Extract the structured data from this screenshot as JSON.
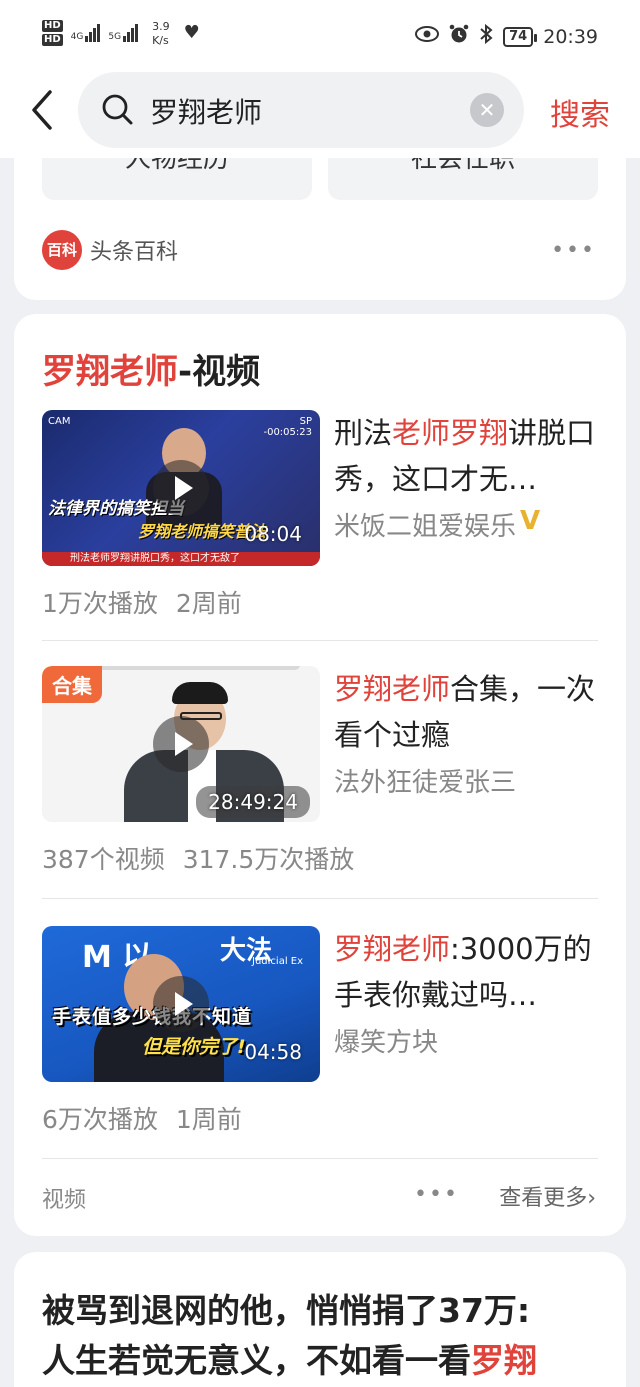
{
  "status_bar": {
    "hd1": "HD",
    "hd2": "HD",
    "net1": "4G",
    "net2": "5G",
    "speed_value": "3.9",
    "speed_unit": "K/s",
    "battery": "74",
    "time": "20:39"
  },
  "search": {
    "query": "罗翔老师",
    "button": "搜索"
  },
  "top_card": {
    "buttons": [
      "人物经历",
      "社会任职"
    ],
    "source_logo": "百科",
    "source_name": "头条百科"
  },
  "video_section": {
    "title_red": "罗翔老师",
    "title_rest": "-视频",
    "items": [
      {
        "title_parts": [
          {
            "text": "刑法",
            "red": false
          },
          {
            "text": "老师罗翔",
            "red": true
          },
          {
            "text": "讲脱口秀，这口才无…",
            "red": false
          }
        ],
        "author": "米饭二姐爱娱乐",
        "verified_badge": "V",
        "duration": "08:04",
        "meta": [
          "1万次播放",
          "2周前"
        ],
        "thumb": {
          "cam": "CAM",
          "tc_line1": "SP",
          "tc_line2": "-00:05:23",
          "caption1": "法律界的搞笑担当",
          "caption2": "罗翔老师搞笑普法",
          "band": "刑法老师罗翔讲脱口秀，这口才无敌了"
        }
      },
      {
        "title_parts": [
          {
            "text": "罗翔老师",
            "red": true
          },
          {
            "text": "合集，一次看个过瘾",
            "red": false
          }
        ],
        "author": "法外狂徒爱张三",
        "badge": "合集",
        "duration": "28:49:24",
        "meta": [
          "387个视频",
          "317.5万次播放"
        ]
      },
      {
        "title_parts": [
          {
            "text": "罗翔老师",
            "red": true
          },
          {
            "text": ":3000万的手表你戴过吗…",
            "red": false
          }
        ],
        "author": "爆笑方块",
        "duration": "04:58",
        "meta": [
          "6万次播放",
          "1周前"
        ],
        "thumb": {
          "logo1": "M 以",
          "logo2": "大法",
          "sub": "Judicial Ex",
          "caption1": "手表值多少钱我不知道",
          "caption2": "但是你完了!"
        }
      }
    ],
    "footer_label": "视频",
    "footer_more": "查看更多›"
  },
  "article": {
    "line1": "被骂到退网的他，悄悄捐了37万:",
    "line2_text": "人生若觉无意义，不如看一看",
    "line2_red": "罗翔"
  },
  "colors": {
    "accent_red": "#e0433b",
    "badge_orange": "#f0693a",
    "verified_gold": "#e8b230"
  },
  "icons": [
    "back-arrow-icon",
    "search-icon",
    "clear-icon",
    "more-dots-icon",
    "play-icon",
    "eye-icon",
    "alarm-icon",
    "bluetooth-icon",
    "heart-rate-icon"
  ]
}
